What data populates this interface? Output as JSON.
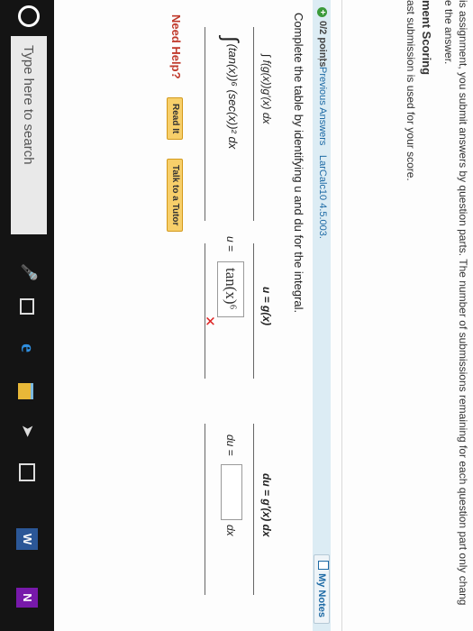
{
  "info": {
    "line1": "is assignment, you submit answers by question parts. The number of submissions remaining for each question part only chang",
    "line2": "e the answer.",
    "heading": "ment Scoring",
    "line3": "ast submission is used for your score."
  },
  "question": {
    "points": "0/2 points",
    "separator": "|",
    "previous_answers": "Previous Answers",
    "reference": "LarCalc10 4.5.003.",
    "my_notes": "My Notes",
    "prompt": "Complete the table by identifying u and du for the integral."
  },
  "table": {
    "col1_header": "∫ f(g(x))g′(x) dx",
    "col2_header": "u = g(x)",
    "col3_header": "du = g′(x) dx",
    "integral": "(tan(x))⁶ (sec(x))² dx",
    "integral_sign": "∫",
    "u_label": "u =",
    "u_answer": "tan(x)⁶",
    "du_label": "du =",
    "du_answer": "",
    "dx_label": "dx",
    "wrong_mark": "✕"
  },
  "help": {
    "label": "Need Help?",
    "read_it": "Read It",
    "talk_tutor": "Talk to a Tutor"
  },
  "taskbar": {
    "search_placeholder": "Type here to search",
    "icons": [
      "microphone-icon",
      "task-view-icon",
      "edge-icon",
      "file-explorer-icon",
      "send-icon",
      "store-icon",
      "word-icon",
      "onenote-icon"
    ],
    "word_letter": "W",
    "onenote_letter": "N",
    "edge_letter": "e"
  },
  "colors": {
    "question_bar": "#dcecf4",
    "link": "#1d6aa5",
    "need_help": "#c0392b",
    "help_button": "#f7cf6a",
    "wrong": "#d22222",
    "taskbar": "#141414"
  }
}
